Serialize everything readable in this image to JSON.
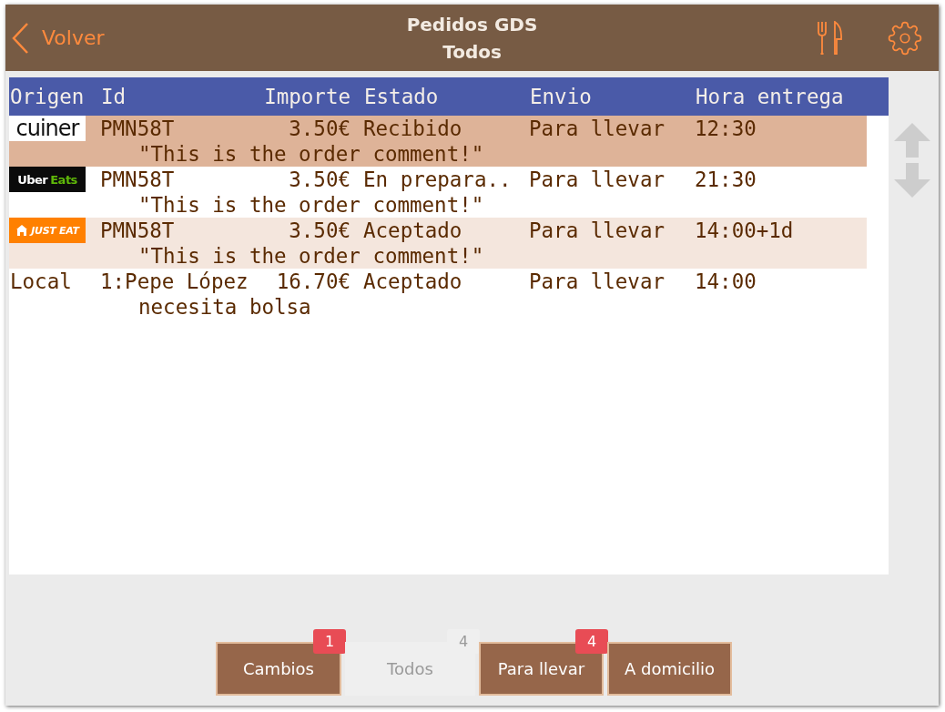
{
  "header": {
    "back_label": "Volver",
    "title": "Pedidos GDS",
    "subtitle": "Todos"
  },
  "table": {
    "columns": [
      "Origen",
      "Id",
      "Importe",
      "Estado",
      "Envio",
      "Hora entrega"
    ],
    "rows": [
      {
        "origin": {
          "kind": "cuiner",
          "text": "cuiner"
        },
        "id": "PMN58T",
        "amount": "3.50€",
        "status": "Recibido",
        "delivery": "Para llevar",
        "time": "12:30",
        "comment": "\"This is the order comment!\"",
        "selected": true
      },
      {
        "origin": {
          "kind": "ubereats",
          "text": "Uber",
          "accent": "Eats"
        },
        "id": "PMN58T",
        "amount": "3.50€",
        "status": "En prepara..",
        "delivery": "Para llevar",
        "time": "21:30",
        "comment": "\"This is the order comment!\"",
        "selected": false
      },
      {
        "origin": {
          "kind": "justeat",
          "text": "JUST EAT"
        },
        "id": "PMN58T",
        "amount": "3.50€",
        "status": "Aceptado",
        "delivery": "Para llevar",
        "time": "14:00+1d",
        "comment": "\"This is the order comment!\"",
        "selected": false
      },
      {
        "origin": {
          "kind": "text",
          "text": "Local"
        },
        "id": "1:Pepe López",
        "amount": "16.70€",
        "status": "Aceptado",
        "delivery": "Para llevar",
        "time": "14:00",
        "comment": "necesita bolsa",
        "selected": false
      }
    ]
  },
  "tabs": [
    {
      "label": "Cambios",
      "badge": "1",
      "selected": false
    },
    {
      "label": "Todos",
      "badge": "4",
      "selected": true
    },
    {
      "label": "Para llevar",
      "badge": "4",
      "selected": false
    },
    {
      "label": "A domicilio",
      "selected": false
    }
  ]
}
